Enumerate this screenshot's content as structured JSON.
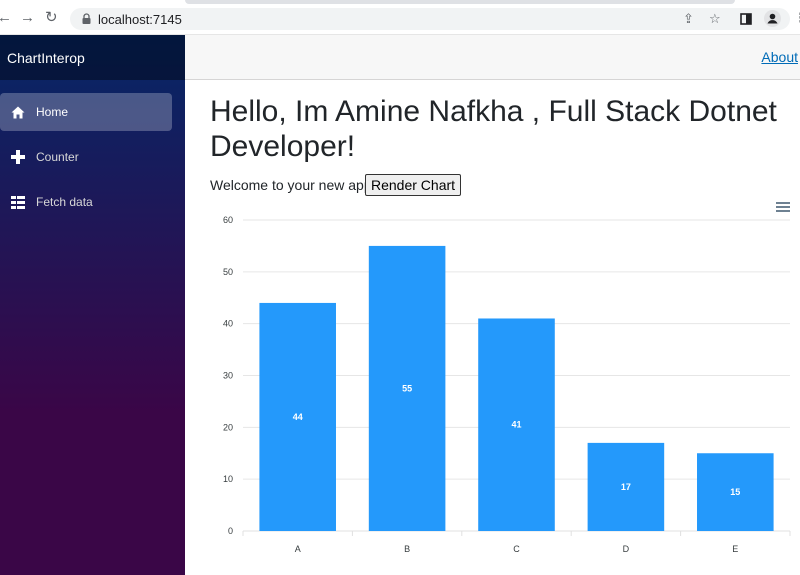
{
  "browser": {
    "url": "localhost:7145"
  },
  "sidebar": {
    "brand": "ChartInterop",
    "items": [
      {
        "label": "Home",
        "icon": "home-icon",
        "active": true
      },
      {
        "label": "Counter",
        "icon": "plus-icon",
        "active": false
      },
      {
        "label": "Fetch data",
        "icon": "list-icon",
        "active": false
      }
    ]
  },
  "top_row": {
    "about_label": "About"
  },
  "main": {
    "title": "Hello, Im Amine Nafkha , Full Stack Dotnet Developer!",
    "welcome": "Welcome to your new app.",
    "render_button": "Render Chart"
  },
  "colors": {
    "bar": "#2499fb",
    "active_nav": "rgba(255,255,255,0.25)"
  },
  "chart_data": {
    "type": "bar",
    "categories": [
      "A",
      "B",
      "C",
      "D",
      "E"
    ],
    "values": [
      44,
      55,
      41,
      17,
      15
    ],
    "ylim": [
      0,
      60
    ],
    "yticks": [
      0,
      10,
      20,
      30,
      40,
      50,
      60
    ],
    "title": "",
    "xlabel": "",
    "ylabel": "",
    "grid": true,
    "data_labels": true
  }
}
